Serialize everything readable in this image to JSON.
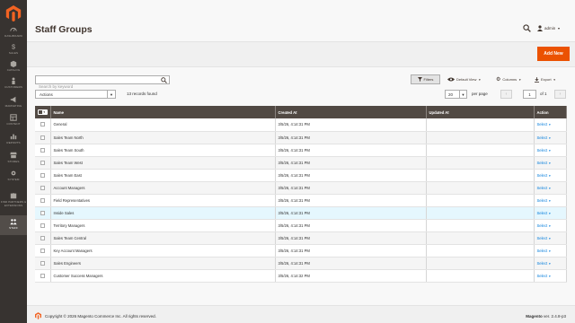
{
  "sidebar": {
    "items": [
      {
        "label": "DASHBOARD",
        "icon": "speedometer-icon"
      },
      {
        "label": "SALES",
        "icon": "dollar-icon"
      },
      {
        "label": "CATALOG",
        "icon": "box-icon"
      },
      {
        "label": "CUSTOMERS",
        "icon": "person-icon"
      },
      {
        "label": "MARKETING",
        "icon": "megaphone-icon"
      },
      {
        "label": "CONTENT",
        "icon": "layout-icon"
      },
      {
        "label": "REPORTS",
        "icon": "bar-chart-icon"
      },
      {
        "label": "STORES",
        "icon": "store-icon"
      },
      {
        "label": "SYSTEM",
        "icon": "gear-icon"
      },
      {
        "label": "FIND PARTNERS & EXTENSIONS",
        "icon": "puzzle-icon"
      },
      {
        "label": "STAFF",
        "icon": "staff-icon",
        "active": true
      }
    ]
  },
  "header": {
    "title": "Staff Groups",
    "user": "admin"
  },
  "actions": {
    "add_new": "Add New"
  },
  "toolbar": {
    "search_placeholder": "Search by keyword",
    "filters": "Filters",
    "default_view": "Default View",
    "columns": "Columns",
    "export": "Export",
    "mass_action": "Actions",
    "records_found": "13 records found",
    "page_size": "20",
    "per_page": "per page",
    "current_page": "1",
    "of_pages": "of 1"
  },
  "grid": {
    "columns": [
      "Name",
      "Created At",
      "Updated At",
      "Action"
    ],
    "action_label": "Select",
    "rows": [
      {
        "name": "General",
        "created": "3/5/26, 4:14:31 PM",
        "updated": ""
      },
      {
        "name": "Sales Team North",
        "created": "3/5/26, 4:14:31 PM",
        "updated": ""
      },
      {
        "name": "Sales Team South",
        "created": "3/5/26, 4:14:31 PM",
        "updated": ""
      },
      {
        "name": "Sales Team West",
        "created": "3/5/26, 4:14:31 PM",
        "updated": ""
      },
      {
        "name": "Sales Team East",
        "created": "3/5/26, 4:14:31 PM",
        "updated": ""
      },
      {
        "name": "Account Managers",
        "created": "3/5/26, 4:14:31 PM",
        "updated": ""
      },
      {
        "name": "Field Representatives",
        "created": "3/5/26, 4:14:31 PM",
        "updated": ""
      },
      {
        "name": "Inside Sales",
        "created": "3/5/26, 4:14:31 PM",
        "updated": "",
        "highlight": true
      },
      {
        "name": "Territory Managers",
        "created": "3/5/26, 4:14:31 PM",
        "updated": ""
      },
      {
        "name": "Sales Team Central",
        "created": "3/5/26, 4:14:31 PM",
        "updated": ""
      },
      {
        "name": "Key Account Managers",
        "created": "3/5/26, 4:14:31 PM",
        "updated": ""
      },
      {
        "name": "Sales Engineers",
        "created": "3/5/26, 4:14:31 PM",
        "updated": ""
      },
      {
        "name": "Customer Success Managers",
        "created": "3/5/26, 4:14:32 PM",
        "updated": ""
      }
    ]
  },
  "footer": {
    "copyright": "Copyright © 2026 Magento Commerce Inc. All rights reserved.",
    "brand": "Magento",
    "version": " ver. 2.4.8-p3"
  },
  "colors": {
    "accent": "#eb5202",
    "sidebar_bg": "#373330",
    "grid_header": "#514943",
    "link": "#007bdb"
  }
}
